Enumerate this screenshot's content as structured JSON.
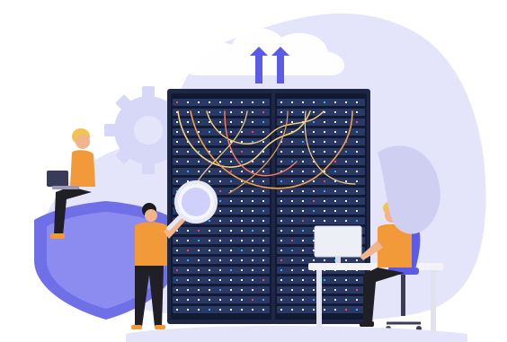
{
  "illustration": {
    "subject": "",
    "colors": {
      "blob": "#E4E4FA",
      "blob_dark": "#CFCFF2",
      "shield": "#6F6FE8",
      "shield_inner": "#8C8CF0",
      "rack": "#1F2747",
      "rack_dark": "#121A33",
      "slot": "#2A3866",
      "led_white": "#F5F7FF",
      "led_cyan": "#37B6FF",
      "led_red": "#FF4B4B",
      "cable_yellow": "#F7D17A",
      "cable_orange": "#F1A04A",
      "shirt": "#F29A3A",
      "skin": "#F2B48C",
      "hair_blond": "#F3C24F",
      "hair_dark": "#1B1B1F",
      "pants": "#1F1F25",
      "arrow": "#5B5BE6",
      "desk": "#F2F2F7",
      "monitor": "#EDEFF7"
    },
    "icons": [
      "cloud-icon",
      "upload-arrow-icon",
      "gear-icon",
      "shield-icon",
      "magnifier-icon",
      "laptop-icon",
      "monitor-icon",
      "office-chair-icon"
    ]
  }
}
